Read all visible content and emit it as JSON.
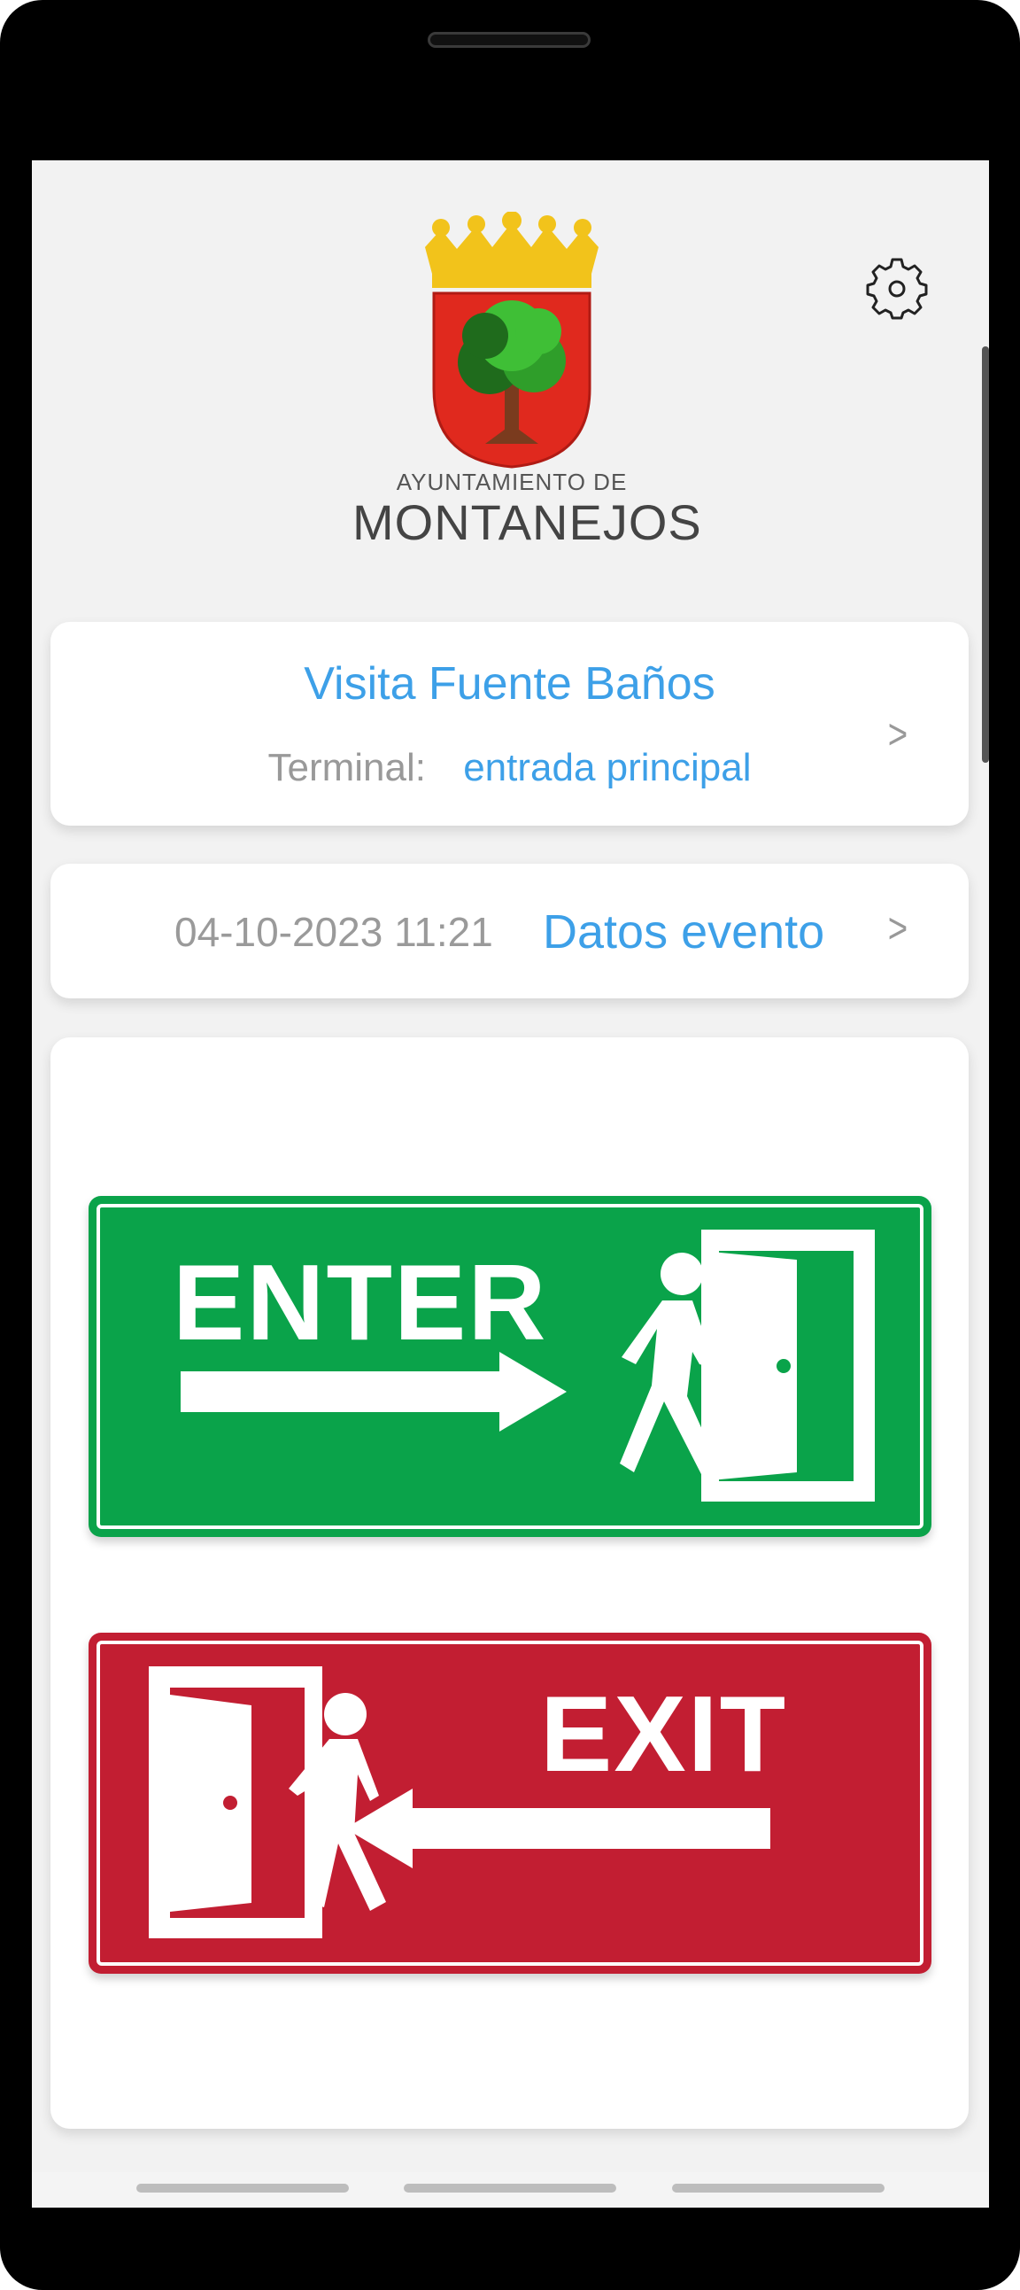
{
  "logo": {
    "subtitle": "AYUNTAMIENTO DE",
    "name": "MONTANEJOS",
    "colors": {
      "crown": "#f2c31b",
      "shield": "#e0291e",
      "tree": "#2f9e2a"
    }
  },
  "settings": {
    "icon": "gear-icon"
  },
  "event_card": {
    "title": "Visita Fuente Baños",
    "terminal_label": "Terminal:",
    "terminal_value": "entrada principal",
    "chevron": ">"
  },
  "date_card": {
    "datetime": "04-10-2023 11:21",
    "link_label": "Datos evento",
    "chevron": ">"
  },
  "actions": {
    "enter": {
      "label": "ENTER",
      "color": "#0aa34a"
    },
    "exit": {
      "label": "EXIT",
      "color": "#c21e32"
    }
  },
  "theme": {
    "accent": "#3da0e8",
    "muted": "#999999",
    "background": "#f2f2f2"
  }
}
